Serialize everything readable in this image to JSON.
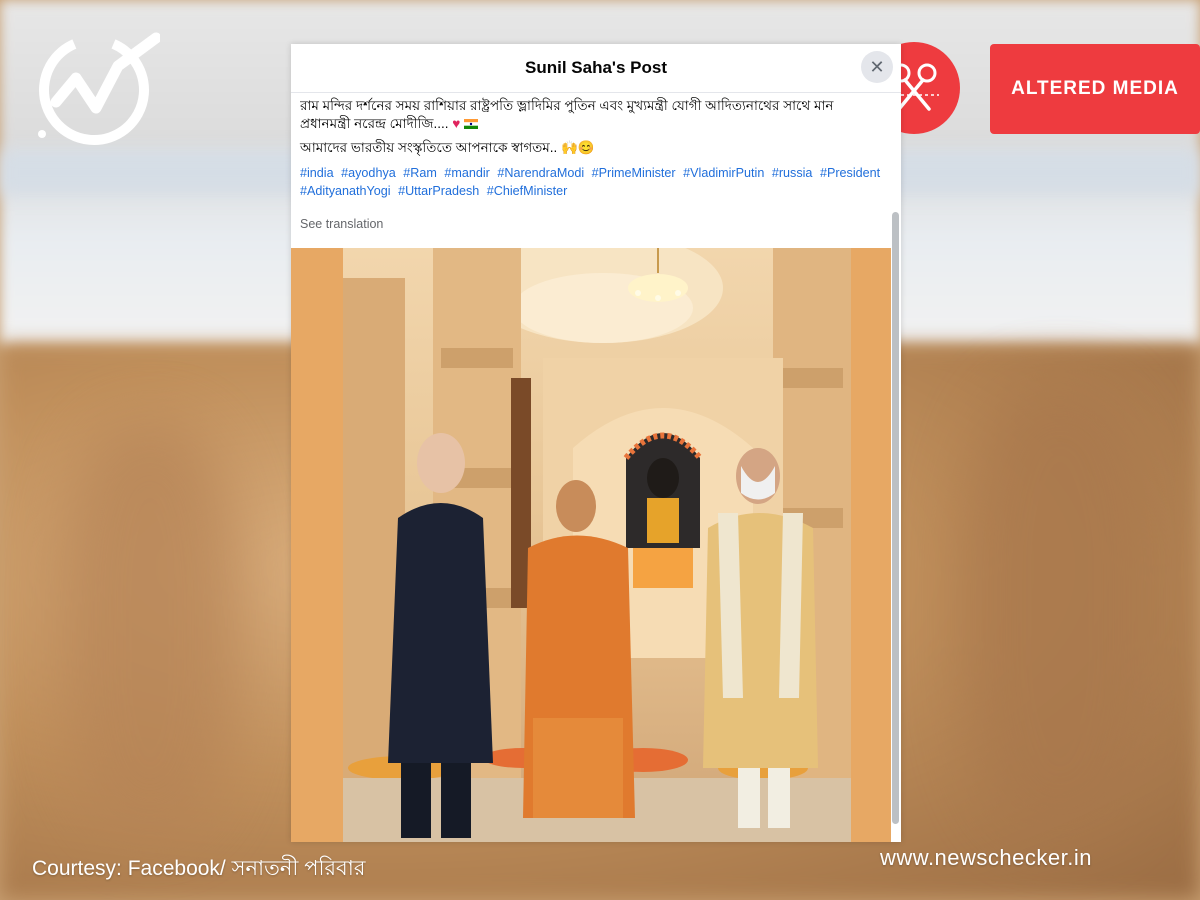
{
  "header": {
    "title": "Sunil Saha's Post",
    "close_label": "✕"
  },
  "post": {
    "line1": "রাম মন্দির দর্শনের সময় রাশিয়ার রাষ্ট্রপতি ভ্লাদিমির পুতিন এবং মুখ্যমন্ত্রী যোগী আদিত্যনাথের সাথে মান",
    "line2": "প্রধানমন্ত্রী নরেন্দ্র মোদীজি....",
    "line2_emoji": "♥",
    "line3": "আমাদের ভারতীয় সংস্কৃতিতে আপনাকে স্বাগতম..",
    "hashtags_row1": [
      "#india",
      "#ayodhya",
      "#Ram",
      "#mandir",
      "#NarendraModi",
      "#PrimeMinister",
      "#VladimirPutin",
      "#russia",
      "#President"
    ],
    "hashtags_row2": [
      "#AdityanathYogi",
      "#UttarPradesh",
      "#ChiefMinister"
    ],
    "see_translation": "See translation"
  },
  "badges": {
    "altered_label": "ALTERED MEDIA",
    "scissor_icon": "scissors-icon"
  },
  "footer": {
    "courtesy": "Courtesy: Facebook/ সনাতনী পরিবার",
    "site": "www.newschecker.in"
  },
  "colors": {
    "accent_red": "#ee3b3f",
    "hashtag_blue": "#216fdb",
    "photo_border": "#e7a864"
  }
}
